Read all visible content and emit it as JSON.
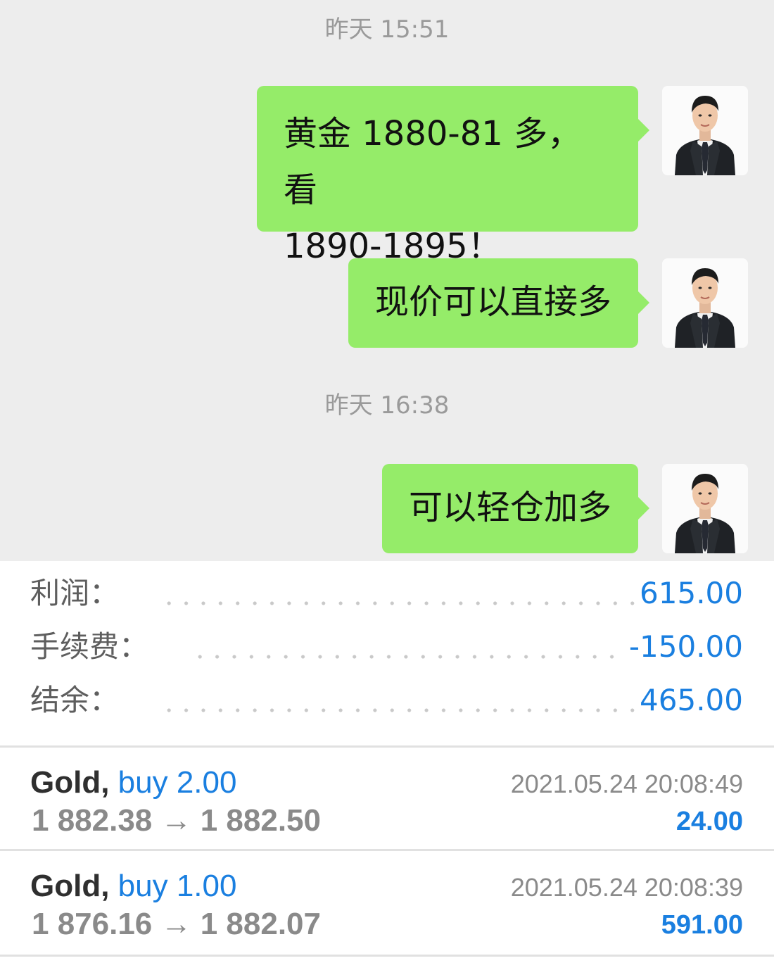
{
  "chat": {
    "timestamps": [
      "昨天 15:51",
      "昨天 16:38"
    ],
    "messages": [
      {
        "line1": "黄金 1880-81 多，看",
        "line2": "1890-1895！"
      },
      {
        "text": "现价可以直接多"
      },
      {
        "text": "可以轻仓加多"
      }
    ],
    "avatar_icon": "user-avatar-suit-icon",
    "bubble_color": "#95ec69",
    "background_color": "#ededed"
  },
  "summary": {
    "rows": [
      {
        "label": "利润：",
        "value": "615.00"
      },
      {
        "label": "手续费：",
        "value": "-150.00"
      },
      {
        "label": "结余：",
        "value": "465.00"
      }
    ],
    "accent_color": "#1a7fe0"
  },
  "trades": [
    {
      "symbol": "Gold,",
      "side": "buy 2.00",
      "prices": "1 882.38 → 1 882.50",
      "time": "2021.05.24 20:08:49",
      "profit": "24.00"
    },
    {
      "symbol": "Gold,",
      "side": "buy 1.00",
      "prices": "1 876.16 → 1 882.07",
      "time": "2021.05.24 20:08:39",
      "profit": "591.00"
    }
  ]
}
